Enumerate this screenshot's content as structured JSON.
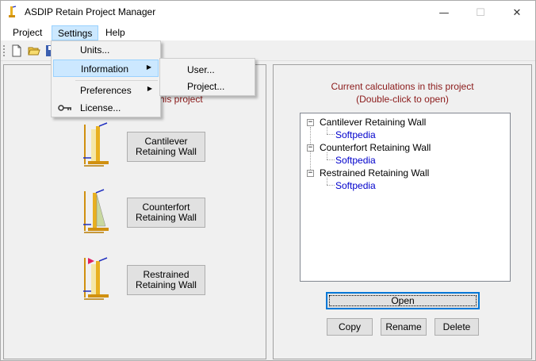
{
  "window": {
    "title": "ASDIP Retain Project Manager",
    "minimize_glyph": "—",
    "maximize_glyph": "☐",
    "close_glyph": "✕"
  },
  "menubar": {
    "project": "Project",
    "settings": "Settings",
    "help": "Help"
  },
  "settings_menu": {
    "items": [
      {
        "label": "Units...",
        "icon": "none",
        "has_submenu": false
      },
      {
        "label": "Information",
        "icon": "none",
        "has_submenu": true,
        "highlighted": true
      },
      {
        "label": "Preferences",
        "icon": "none",
        "has_submenu": true
      },
      {
        "label": "License...",
        "icon": "key-icon",
        "has_submenu": false
      }
    ],
    "submenu_arrow": "▶"
  },
  "information_submenu": {
    "items": [
      "User...",
      "Project..."
    ]
  },
  "left_panel": {
    "caption": "his project",
    "walls": [
      {
        "label": "Cantilever\nRetaining Wall",
        "icon": "cantilever-wall-icon"
      },
      {
        "label": "Counterfort\nRetaining Wall",
        "icon": "counterfort-wall-icon"
      },
      {
        "label": "Restrained\nRetaining Wall",
        "icon": "restrained-wall-icon"
      }
    ]
  },
  "right_panel": {
    "caption_line1": "Current calculations in this project",
    "caption_line2": "(Double-click to open)",
    "tree": [
      {
        "label": "Cantilever Retaining Wall",
        "children": [
          "Softpedia"
        ]
      },
      {
        "label": "Counterfort Retaining Wall",
        "children": [
          "Softpedia"
        ]
      },
      {
        "label": "Restrained Retaining Wall",
        "children": [
          "Softpedia"
        ]
      }
    ],
    "expanded_glyph": "−",
    "buttons": {
      "open": "Open",
      "copy": "Copy",
      "rename": "Rename",
      "delete": "Delete"
    }
  },
  "colors": {
    "caption_red": "#8b1a1a",
    "tree_child_blue": "#0000cc",
    "menu_highlight": "#cce8ff",
    "focus_blue": "#0078d7"
  }
}
